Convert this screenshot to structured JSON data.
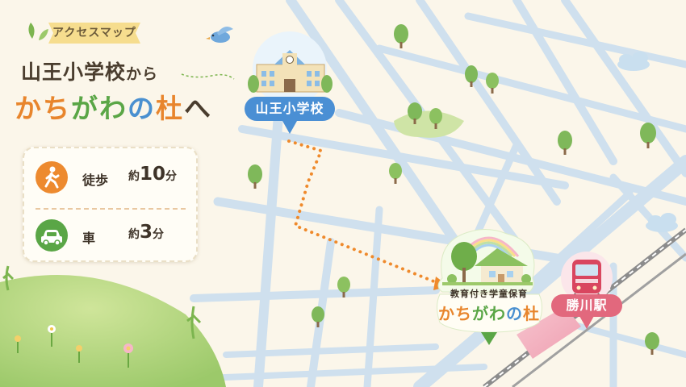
{
  "ribbon": {
    "text": "アクセスマップ"
  },
  "title": {
    "line1_main": "山王小学校",
    "line1_suffix": "から",
    "line2_chars": [
      {
        "char": "か",
        "color": "#e8852c"
      },
      {
        "char": "ち",
        "color": "#e8852c"
      },
      {
        "char": "が",
        "color": "#5aa646"
      },
      {
        "char": "わ",
        "color": "#5aa646"
      },
      {
        "char": "の",
        "color": "#4a90d0"
      },
      {
        "char": "杜",
        "color": "#e8852c"
      },
      {
        "char": "へ",
        "color": "#4a3d2e"
      }
    ]
  },
  "access": {
    "walk": {
      "icon": "walking-person-icon",
      "label": "徒歩",
      "prefix": "約",
      "value": "10",
      "unit": "分",
      "color": "#ed8a2f"
    },
    "car": {
      "icon": "car-icon",
      "label": "車",
      "prefix": "約",
      "value": "3",
      "unit": "分",
      "color": "#5aa646"
    }
  },
  "markers": {
    "school": {
      "label": "山王小学校",
      "color": "#4a8fd4",
      "icon": "school-building-icon"
    },
    "nursery": {
      "sub": "教育付き学童保育",
      "name_chars": [
        {
          "char": "か",
          "color": "#e8852c"
        },
        {
          "char": "ち",
          "color": "#e8852c"
        },
        {
          "char": "が",
          "color": "#5aa646"
        },
        {
          "char": "わ",
          "color": "#5aa646"
        },
        {
          "char": "の",
          "color": "#4a90d0"
        },
        {
          "char": "杜",
          "color": "#e8852c"
        }
      ],
      "icon": "house-with-rainbow-icon",
      "pin_color": "#5aa646"
    },
    "station": {
      "label": "勝川駅",
      "color": "#e2687d",
      "icon": "train-icon"
    }
  },
  "route": {
    "color": "#ef8a2c",
    "style": "dotted"
  }
}
